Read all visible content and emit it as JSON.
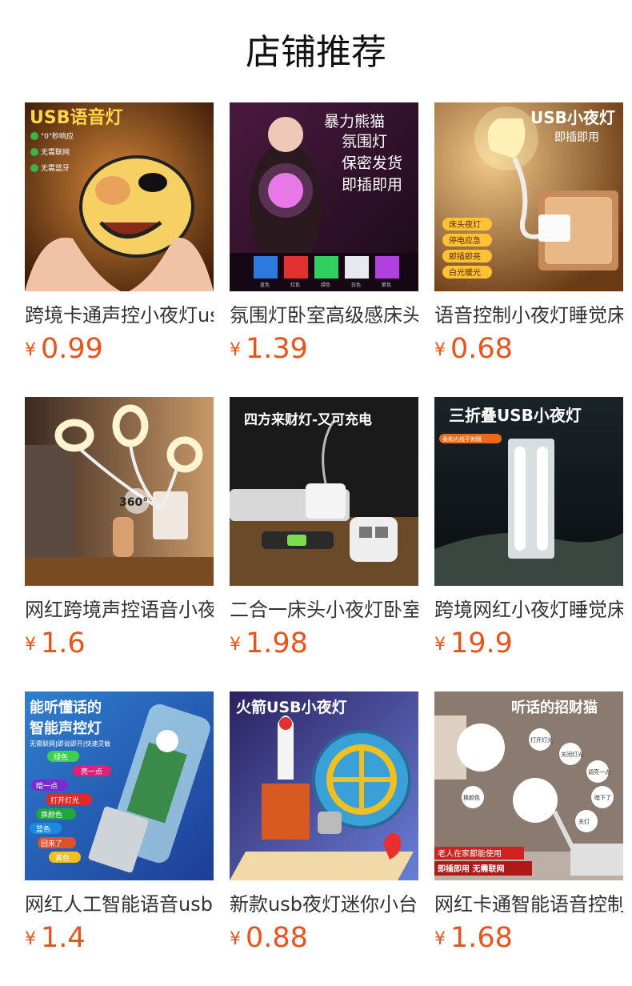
{
  "page": {
    "title": "店铺推荐"
  },
  "products": [
    {
      "name": "跨境卡通声控小夜灯usb",
      "currency": "¥",
      "price": "0.99",
      "image": {
        "headline": "USB语音灯",
        "features": [
          "\"0\"秒响应",
          "无需联网",
          "无需蓝牙"
        ],
        "palette": [
          "#3a1a08",
          "#c9762e",
          "#f7d063"
        ]
      }
    },
    {
      "name": "氛围灯卧室高级感床头",
      "currency": "¥",
      "price": "1.39",
      "image": {
        "lines": [
          "暴力熊猫",
          "氛围灯",
          "保密发货",
          "即插即用"
        ],
        "swatch_labels": [
          "蓝色",
          "红色",
          "绿色",
          "白色",
          "紫色"
        ],
        "palette": [
          "#2a1030",
          "#7a2f8a",
          "#e06ad8"
        ]
      }
    },
    {
      "name": "语音控制小夜灯睡觉床头",
      "currency": "¥",
      "price": "0.68",
      "image": {
        "headline": "USB小夜灯",
        "subline": "即插即用",
        "features": [
          "床头夜灯",
          "停电应急",
          "即插即亮",
          "白光暖光"
        ],
        "palette": [
          "#6a3a14",
          "#e0a35a",
          "#fff0b8"
        ]
      }
    },
    {
      "name": "网红跨境声控语音小夜灯",
      "currency": "¥",
      "price": "1.6",
      "image": {
        "badge": "360°",
        "palette": [
          "#3b2a20",
          "#b8864e",
          "#fff4d0"
        ]
      }
    },
    {
      "name": "二合一床头小夜灯卧室",
      "currency": "¥",
      "price": "1.98",
      "image": {
        "headline": "四方来财灯-又可充电",
        "palette": [
          "#1a1a1a",
          "#6b4a2a",
          "#ffffff"
        ]
      }
    },
    {
      "name": "跨境网红小夜灯睡觉床头",
      "currency": "¥",
      "price": "19.9",
      "image": {
        "headline": "三折叠USB小夜灯",
        "tag": "柔和光线不刺眼",
        "palette": [
          "#0e1418",
          "#3a4640",
          "#eef2f4"
        ]
      }
    },
    {
      "name": "网红人工智能语音usb",
      "currency": "¥",
      "price": "1.4",
      "image": {
        "lines": [
          "能听懂话的",
          "智能声控灯"
        ],
        "subline": "无需联网|即说即开|快速灵敏",
        "commands": [
          "绿色",
          "亮一点",
          "暗一点",
          "打开灯光",
          "换颜色",
          "蓝色",
          "回来了",
          "黄色"
        ],
        "palette": [
          "#1d3e96",
          "#2f7fd0",
          "#ffffff"
        ]
      }
    },
    {
      "name": "新款usb夜灯迷你小台灯",
      "currency": "¥",
      "price": "0.88",
      "image": {
        "headline": "火箭USB小夜灯",
        "palette": [
          "#2b2160",
          "#6a7fd8",
          "#f2d9a8"
        ]
      }
    },
    {
      "name": "网红卡通智能语音控制",
      "currency": "¥",
      "price": "1.68",
      "image": {
        "headline": "听话的招财猫",
        "bubbles": [
          "打开灯光",
          "关闭灯光",
          "调亮一点",
          "暗下了",
          "换颜色",
          "关灯"
        ],
        "footer": [
          "老人在家都能使用",
          "即插即用 无需联网"
        ],
        "palette": [
          "#7a6a62",
          "#c9bbb2",
          "#ffffff"
        ]
      }
    }
  ]
}
